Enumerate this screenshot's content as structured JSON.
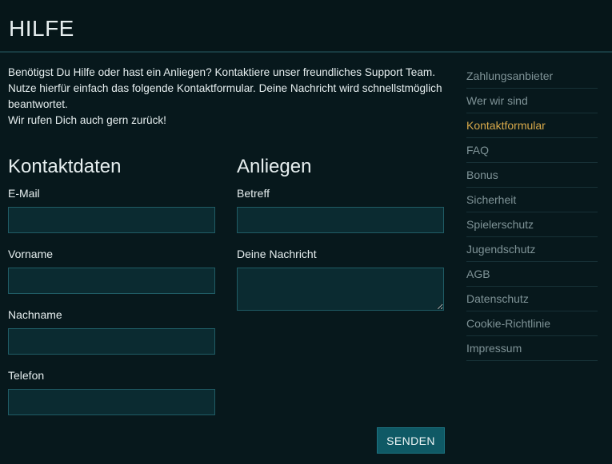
{
  "header": {
    "title": "HILFE"
  },
  "intro": {
    "line1": "Benötigst Du Hilfe oder hast ein Anliegen? Kontaktiere unser freundliches Support Team.",
    "line2": "Nutze hierfür einfach das folgende Kontaktformular. Deine Nachricht wird schnellstmöglich beantwortet.",
    "line3": "Wir rufen Dich auch gern zurück!"
  },
  "contact": {
    "title": "Kontaktdaten",
    "fields": [
      {
        "label": "E-Mail",
        "value": "",
        "placeholder": ""
      },
      {
        "label": "Vorname",
        "value": "",
        "placeholder": ""
      },
      {
        "label": "Nachname",
        "value": "",
        "placeholder": ""
      },
      {
        "label": "Telefon",
        "value": "",
        "placeholder": ""
      }
    ]
  },
  "concern": {
    "title": "Anliegen",
    "fields": [
      {
        "label": "Betreff",
        "value": "",
        "placeholder": ""
      },
      {
        "label": "Deine Nachricht",
        "value": "",
        "placeholder": ""
      }
    ]
  },
  "actions": {
    "send_label": "SENDEN"
  },
  "sidebar": {
    "items": [
      {
        "label": "Zahlungsanbieter",
        "active": false
      },
      {
        "label": "Wer wir sind",
        "active": false
      },
      {
        "label": "Kontaktformular",
        "active": true
      },
      {
        "label": "FAQ",
        "active": false
      },
      {
        "label": "Bonus",
        "active": false
      },
      {
        "label": "Sicherheit",
        "active": false
      },
      {
        "label": "Spielerschutz",
        "active": false
      },
      {
        "label": "Jugendschutz",
        "active": false
      },
      {
        "label": "AGB",
        "active": false
      },
      {
        "label": "Datenschutz",
        "active": false
      },
      {
        "label": "Cookie-Richtlinie",
        "active": false
      },
      {
        "label": "Impressum",
        "active": false
      }
    ]
  },
  "colors": {
    "background": "#07181c",
    "input_background": "#0b2b31",
    "input_border": "#1f5c65",
    "button": "#0f5965",
    "active_link": "#d8a94a",
    "muted_link": "#7f9397"
  }
}
